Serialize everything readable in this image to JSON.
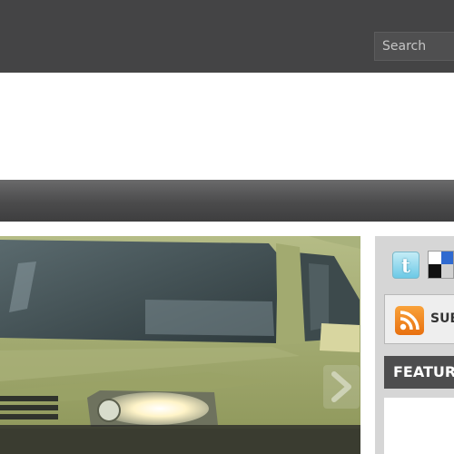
{
  "header": {
    "search": {
      "placeholder": "Search",
      "value": ""
    }
  },
  "slider": {
    "next_icon": "chevron-right-icon"
  },
  "sidebar": {
    "social": [
      {
        "name": "twitter",
        "icon": "twitter-icon",
        "glyph": "t"
      },
      {
        "name": "delicious",
        "icon": "delicious-icon"
      }
    ],
    "subscribe": {
      "icon": "rss-icon",
      "label": "SUBSCRIBE"
    },
    "featured": {
      "title": "FEATURED"
    }
  },
  "colors": {
    "topbar": "#444445",
    "navbar": "#4b4b4c",
    "sidebar": "#d6d6d6",
    "featured_header": "#4d4d4e",
    "rss": "#f08a1e",
    "twitter": "#6cc9e6"
  }
}
